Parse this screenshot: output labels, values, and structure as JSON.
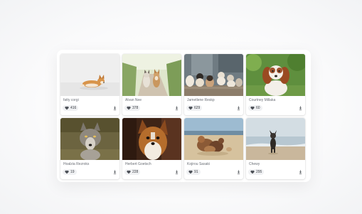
{
  "gallery": {
    "cards": [
      {
        "author": "fatty corgi",
        "likes": "416",
        "photo": "corgi-lying-photo",
        "colors": {
          "bg": "#eeeeee",
          "subject": "#d9944a"
        }
      },
      {
        "author": "Alvan Nee",
        "likes": "378",
        "photo": "two-dogs-path-photo",
        "colors": {
          "bg": "#9fb87c",
          "subject": "#c9a27a"
        }
      },
      {
        "author": "Jametlene Reskp",
        "likes": "629",
        "photo": "puppies-group-photo",
        "colors": {
          "bg": "#5d6b73",
          "subject": "#d8cbb6"
        }
      },
      {
        "author": "Courtney Millaka",
        "likes": "60",
        "photo": "spaniel-photo",
        "colors": {
          "bg": "#5b8a3a",
          "subject": "#a0522d"
        }
      },
      {
        "author": "Hoalzia Rezroks",
        "likes": "19",
        "photo": "wolfdog-photo",
        "colors": {
          "bg": "#6a6440",
          "subject": "#9a948c"
        }
      },
      {
        "author": "Herbert Goetsch",
        "likes": "228",
        "photo": "pomeranian-photo",
        "colors": {
          "bg": "#4a2a1a",
          "subject": "#b06a2a"
        }
      },
      {
        "author": "Kojirou Sasaki",
        "likes": "91",
        "photo": "beach-dogs-photo",
        "colors": {
          "bg": "#8fb0c8",
          "subject": "#8a5a3a"
        }
      },
      {
        "author": "Chewy",
        "likes": "295",
        "photo": "dog-at-sea-photo",
        "colors": {
          "bg": "#c6d4dc",
          "subject": "#3a3530"
        }
      }
    ]
  }
}
